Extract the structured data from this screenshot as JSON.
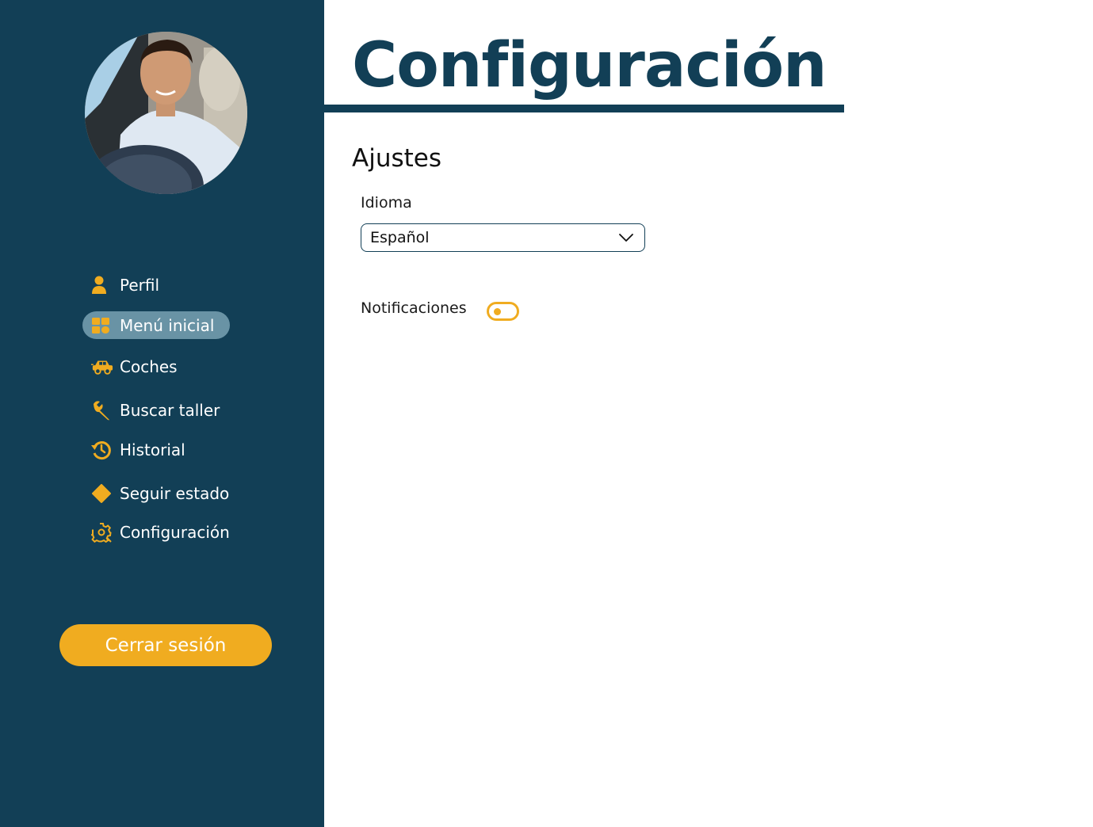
{
  "sidebar": {
    "avatar_alt": "Foto de perfil",
    "items": [
      {
        "label": "Perfil",
        "icon": "user-icon",
        "active": false
      },
      {
        "label": "Menú inicial",
        "icon": "dashboard-icon",
        "active": true
      },
      {
        "label": "Coches",
        "icon": "car-icon",
        "active": false
      },
      {
        "label": "Buscar taller",
        "icon": "wrench-icon",
        "active": false
      },
      {
        "label": "Historial",
        "icon": "history-icon",
        "active": false
      },
      {
        "label": "Seguir estado",
        "icon": "diamond-icon",
        "active": false
      },
      {
        "label": "Configuración",
        "icon": "gear-icon",
        "active": false
      }
    ],
    "logout_label": "Cerrar sesión"
  },
  "main": {
    "title": "Configuración",
    "section_title": "Ajustes",
    "language_label": "Idioma",
    "language_value": "Español",
    "notifications_label": "Notificaciones",
    "notifications_on": false
  },
  "colors": {
    "sidebar_bg": "#123f56",
    "accent": "#f0ac20",
    "active_item_bg": "#6993a5",
    "title": "#123f56"
  }
}
